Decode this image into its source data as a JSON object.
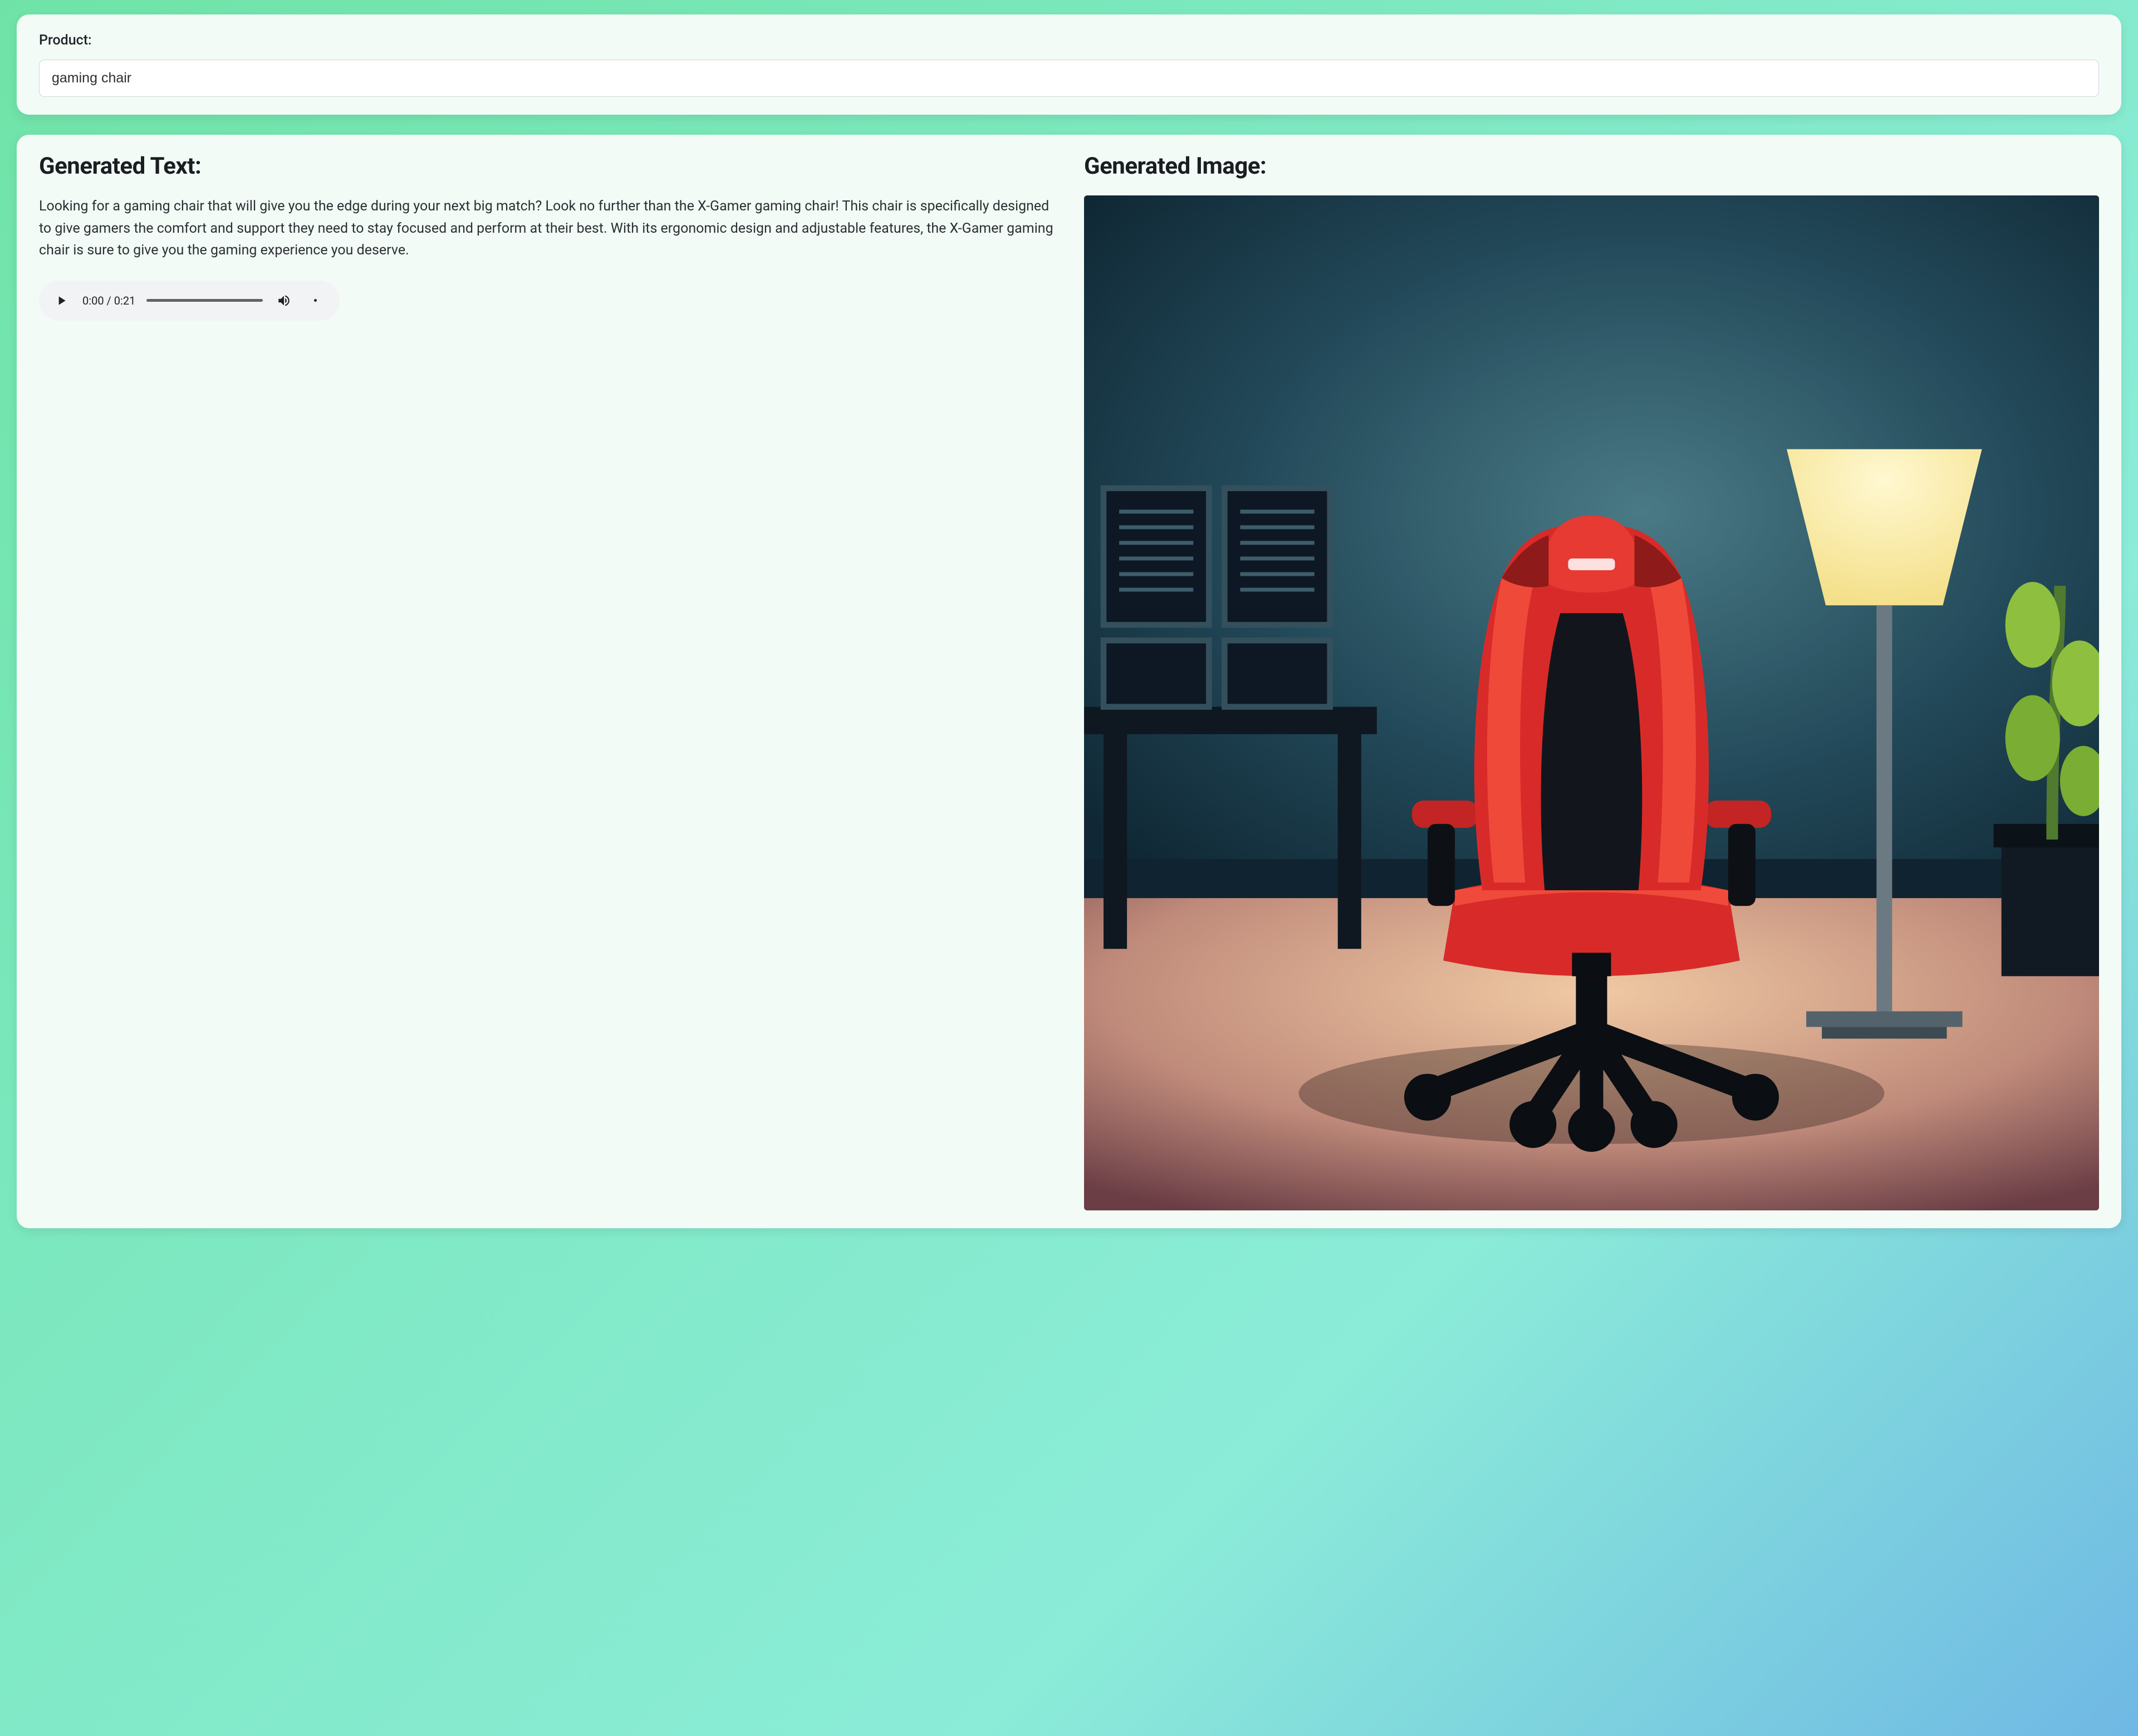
{
  "input": {
    "label": "Product:",
    "value": "gaming chair"
  },
  "output": {
    "text_title": "Generated Text:",
    "image_title": "Generated Image:",
    "text_body": "Looking for a gaming chair that will give you the edge during your next big match? Look no further than the X-Gamer gaming chair! This chair is specifically designed to give gamers the comfort and support they need to stay focused and perform at their best. With its ergonomic design and adjustable features, the X-Gamer gaming chair is sure to give you the gaming experience you deserve."
  },
  "audio": {
    "current_time": "0:00",
    "duration": "0:21"
  },
  "image": {
    "alt": "gaming-chair-illustration"
  }
}
